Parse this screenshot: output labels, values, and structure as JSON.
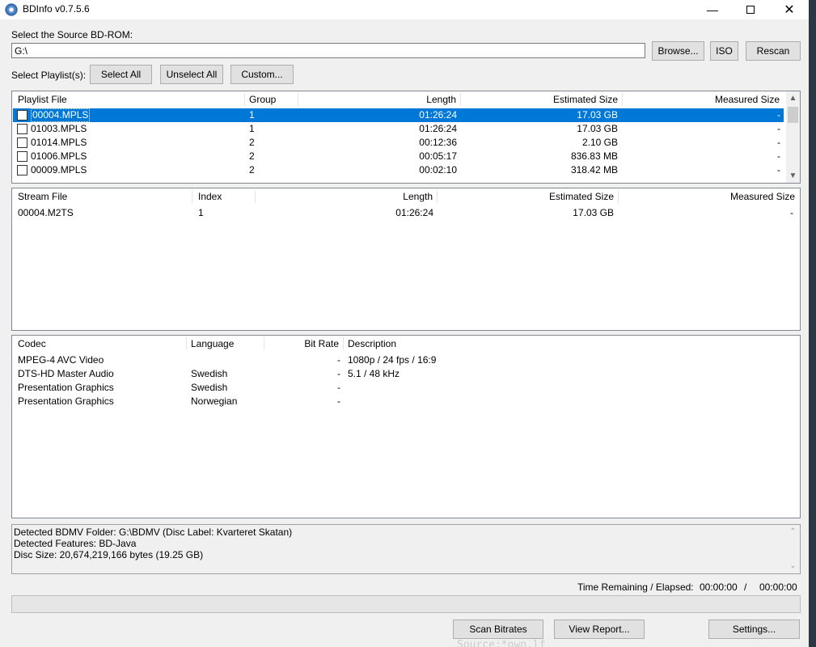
{
  "window": {
    "title": "BDInfo v0.7.5.6"
  },
  "source": {
    "label": "Select the Source BD-ROM:",
    "value": "G:\\",
    "browse": "Browse...",
    "iso": "ISO",
    "rescan": "Rescan"
  },
  "playlist_controls": {
    "label": "Select Playlist(s):",
    "select_all": "Select All",
    "unselect_all": "Unselect All",
    "custom": "Custom..."
  },
  "playlists": {
    "headers": [
      "Playlist File",
      "Group",
      "Length",
      "Estimated Size",
      "Measured Size"
    ],
    "rows": [
      {
        "file": "00004.MPLS",
        "group": "1",
        "length": "01:26:24",
        "est": "17.03 GB",
        "measured": "-"
      },
      {
        "file": "01003.MPLS",
        "group": "1",
        "length": "01:26:24",
        "est": "17.03 GB",
        "measured": "-"
      },
      {
        "file": "01014.MPLS",
        "group": "2",
        "length": "00:12:36",
        "est": "2.10 GB",
        "measured": "-"
      },
      {
        "file": "01006.MPLS",
        "group": "2",
        "length": "00:05:17",
        "est": "836.83 MB",
        "measured": "-"
      },
      {
        "file": "00009.MPLS",
        "group": "2",
        "length": "00:02:10",
        "est": "318.42 MB",
        "measured": "-"
      }
    ]
  },
  "streams": {
    "headers": [
      "Stream File",
      "Index",
      "Length",
      "Estimated Size",
      "Measured Size"
    ],
    "rows": [
      {
        "file": "00004.M2TS",
        "index": "1",
        "length": "01:26:24",
        "est": "17.03 GB",
        "measured": "-"
      }
    ]
  },
  "codecs": {
    "headers": [
      "Codec",
      "Language",
      "Bit Rate",
      "Description"
    ],
    "rows": [
      {
        "codec": "MPEG-4 AVC Video",
        "lang": "",
        "bitrate": "-",
        "desc": "1080p / 24 fps / 16:9"
      },
      {
        "codec": "DTS-HD Master Audio",
        "lang": "Swedish",
        "bitrate": "-",
        "desc": "5.1 / 48 kHz"
      },
      {
        "codec": "Presentation Graphics",
        "lang": "Swedish",
        "bitrate": "-",
        "desc": ""
      },
      {
        "codec": "Presentation Graphics",
        "lang": "Norwegian",
        "bitrate": "-",
        "desc": ""
      }
    ]
  },
  "info": {
    "lines": [
      "Detected BDMV Folder: G:\\BDMV (Disc Label: Kvarteret Skatan)",
      "Detected Features: BD-Java",
      "Disc Size: 20,674,219,166 bytes (19.25 GB)"
    ]
  },
  "status": {
    "label": "Time Remaining / Elapsed:",
    "remaining": "00:00:00",
    "sep": "/",
    "elapsed": "00:00:00",
    "progress": 0
  },
  "footer": {
    "scan": "Scan Bitrates",
    "report": "View Report...",
    "settings": "Settings..."
  },
  "background": {
    "text": "Source:*own.lf"
  },
  "colors": {
    "selection": "#0078d7"
  }
}
